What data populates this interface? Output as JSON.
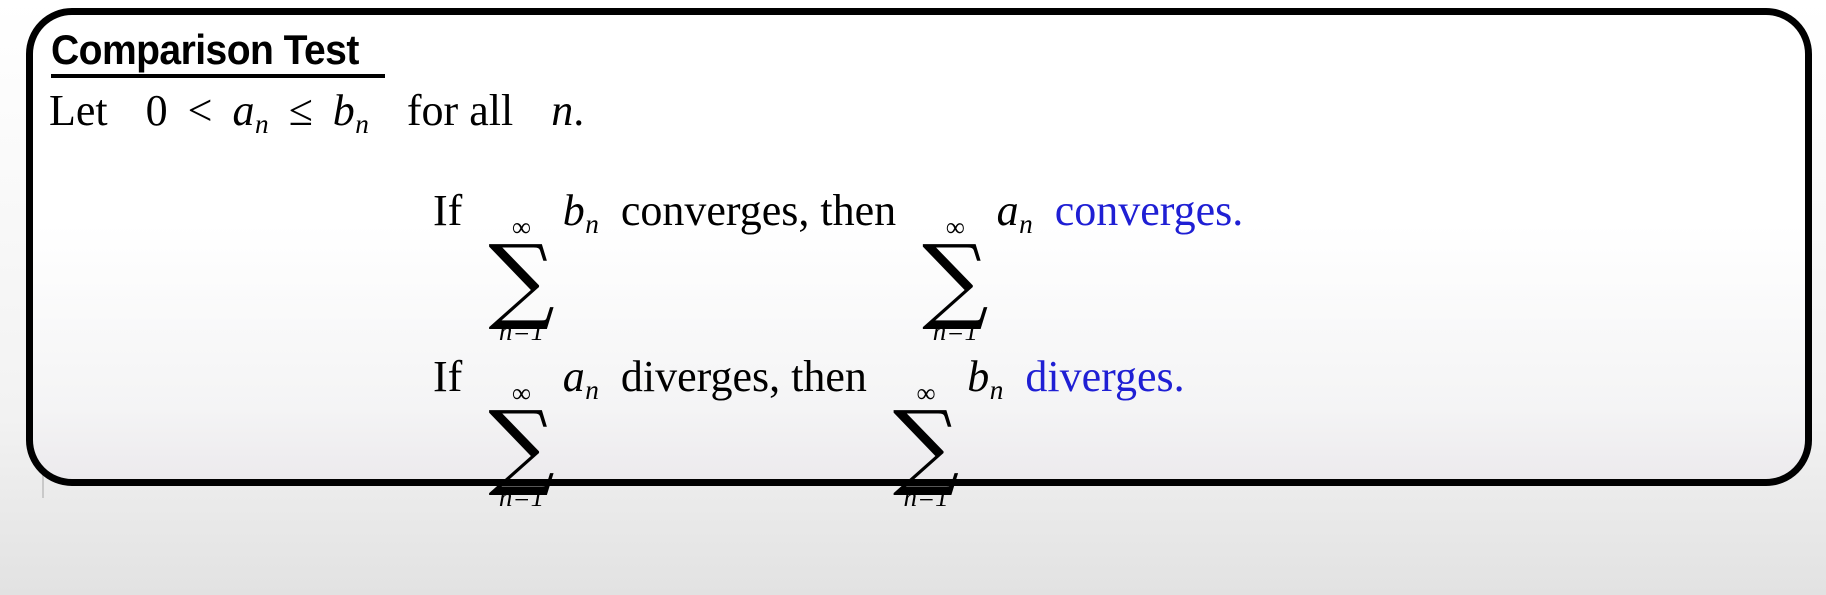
{
  "slide": {
    "title": "Comparison Test",
    "accent_color": "#1f1fd4",
    "border_color": "#000000",
    "hypothesis": {
      "lead": "Let",
      "zero": "0",
      "rel1": "<",
      "var_a": "a",
      "sub_a": "n",
      "rel2": "≤",
      "var_b": "b",
      "sub_b": "n",
      "quantifier": "for all",
      "index": "n",
      "period": "."
    },
    "statements": [
      {
        "if_word": "If",
        "sum1": {
          "upper": "∞",
          "symbol": "∑",
          "lower": "n=1",
          "term": "b",
          "term_sub": "n"
        },
        "verb1": "converges, then",
        "sum2": {
          "upper": "∞",
          "symbol": "∑",
          "lower": "n=1",
          "term": "a",
          "term_sub": "n"
        },
        "conclusion": "converges."
      },
      {
        "if_word": "If",
        "sum1": {
          "upper": "∞",
          "symbol": "∑",
          "lower": "n=1",
          "term": "a",
          "term_sub": "n"
        },
        "verb1": "diverges, then",
        "sum2": {
          "upper": "∞",
          "symbol": "∑",
          "lower": "n=1",
          "term": "b",
          "term_sub": "n"
        },
        "conclusion": "diverges."
      }
    ]
  }
}
